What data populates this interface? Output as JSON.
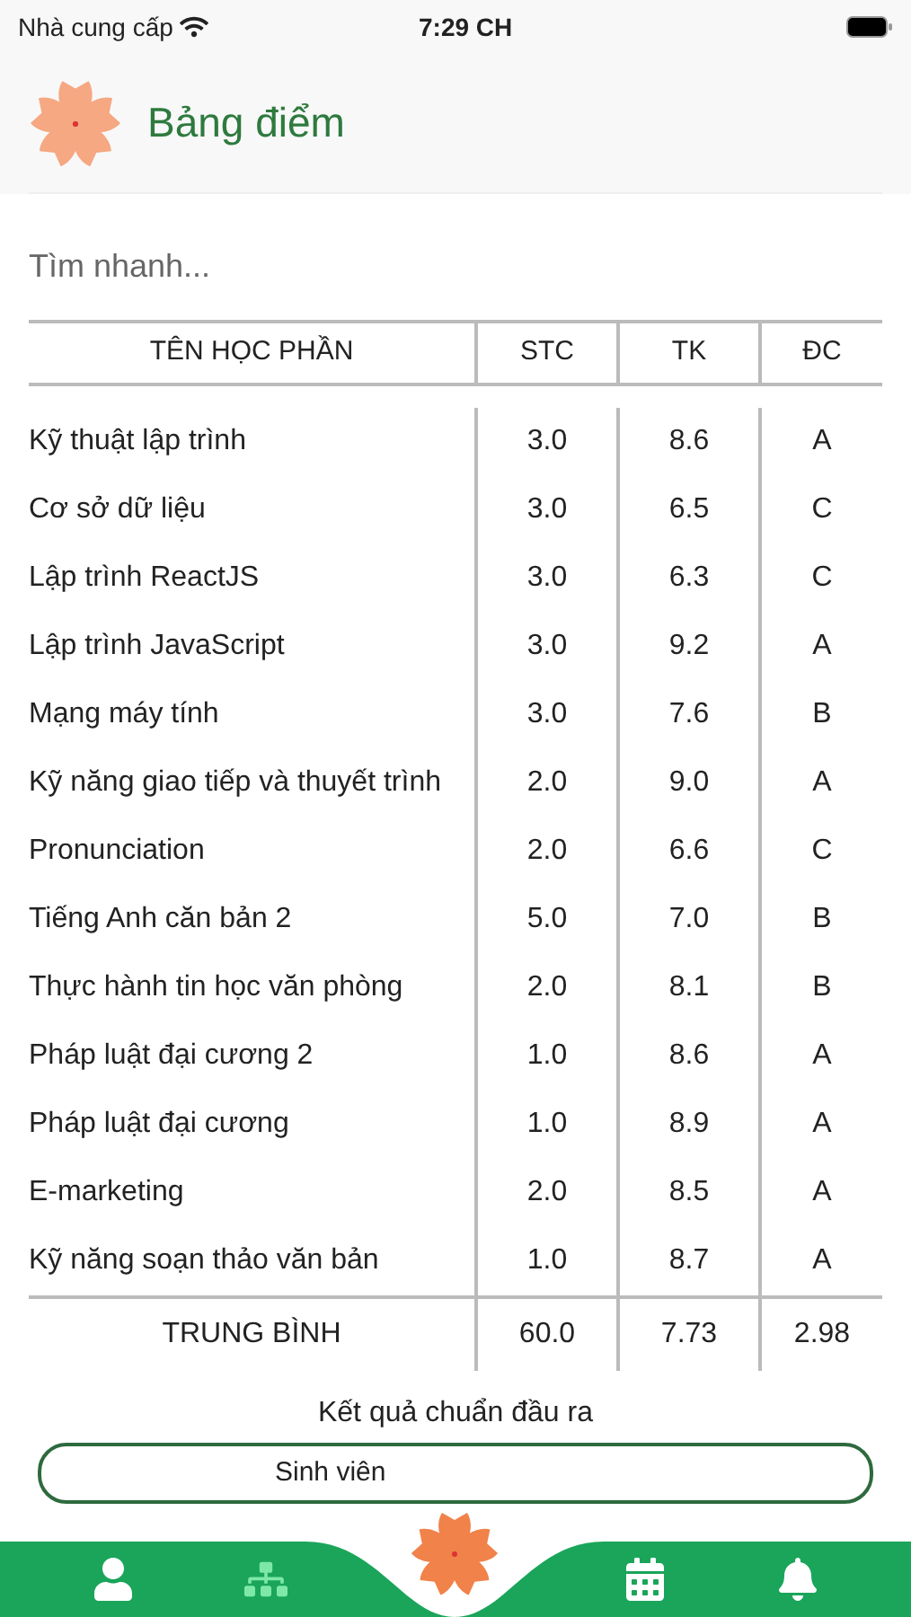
{
  "status_bar": {
    "carrier": "Nhà cung cấp",
    "time": "7:29 CH"
  },
  "header": {
    "title": "Bảng điểm"
  },
  "search": {
    "placeholder": "Tìm nhanh..."
  },
  "table": {
    "columns": [
      "TÊN HỌC PHẦN",
      "STC",
      "TK",
      "ĐC"
    ],
    "rows": [
      {
        "name": "Kỹ thuật lập trình",
        "credits": "3.0",
        "score": "8.6",
        "grade": "A"
      },
      {
        "name": "Cơ sở dữ liệu",
        "credits": "3.0",
        "score": "6.5",
        "grade": "C"
      },
      {
        "name": "Lập trình ReactJS",
        "credits": "3.0",
        "score": "6.3",
        "grade": "C"
      },
      {
        "name": "Lập trình JavaScript",
        "credits": "3.0",
        "score": "9.2",
        "grade": "A"
      },
      {
        "name": "Mạng máy tính",
        "credits": "3.0",
        "score": "7.6",
        "grade": "B"
      },
      {
        "name": "Kỹ năng giao tiếp và thuyết trình",
        "credits": "2.0",
        "score": "9.0",
        "grade": "A"
      },
      {
        "name": "Pronunciation",
        "credits": "2.0",
        "score": "6.6",
        "grade": "C"
      },
      {
        "name": "Tiếng Anh căn bản 2",
        "credits": "5.0",
        "score": "7.0",
        "grade": "B"
      },
      {
        "name": "Thực hành tin học văn phòng",
        "credits": "2.0",
        "score": "8.1",
        "grade": "B"
      },
      {
        "name": "Pháp luật đại cương 2",
        "credits": "1.0",
        "score": "8.6",
        "grade": "A"
      },
      {
        "name": "Pháp luật đại cương",
        "credits": "1.0",
        "score": "8.9",
        "grade": "A"
      },
      {
        "name": "E-marketing",
        "credits": "2.0",
        "score": "8.5",
        "grade": "A"
      },
      {
        "name": "Kỹ năng soạn thảo văn bản",
        "credits": "1.0",
        "score": "8.7",
        "grade": "A"
      }
    ],
    "footer": [
      "TRUNG BÌNH",
      "60.0",
      "7.73",
      "2.98"
    ]
  },
  "outcome": {
    "title": "Kết quả chuẩn đầu ra",
    "card_label": "Sinh viên"
  },
  "bottom_nav": [
    {
      "kind": "user",
      "selected": false
    },
    {
      "kind": "hierarchy",
      "selected": true
    },
    {
      "kind": "calendar",
      "selected": false
    },
    {
      "kind": "bell",
      "selected": false
    }
  ]
}
